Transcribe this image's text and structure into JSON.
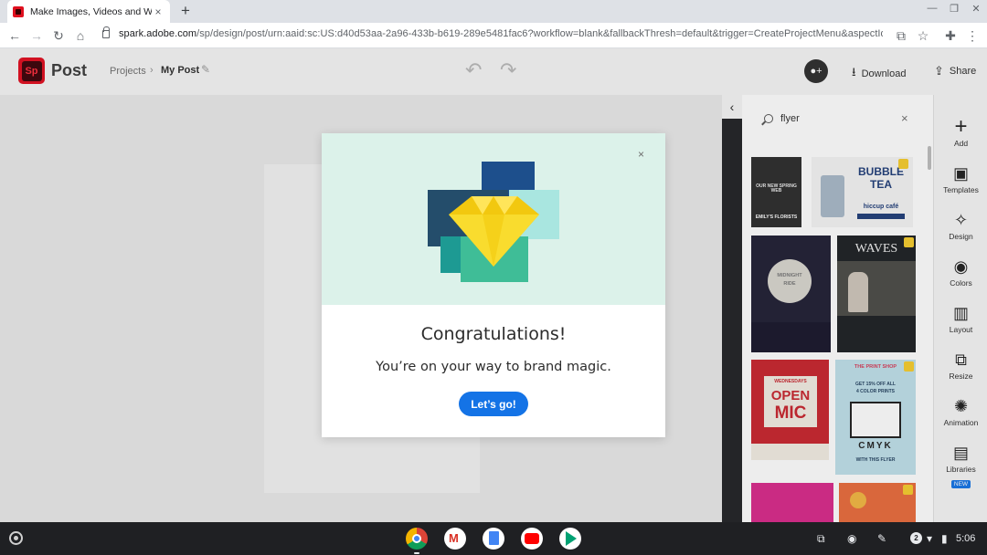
{
  "browser": {
    "tab_title": "Make Images, Videos and Web St",
    "tab_close": "×",
    "new_tab": "+",
    "url_host": "spark.adobe.com",
    "url_path": "/sp/design/post/urn:aaid:sc:US:d40d53aa-2a96-433b-b619-289e5481fac6?workflow=blank&fallbackThresh=default&trigger=CreateProjectMenu&aspectId=Post..."
  },
  "app": {
    "logo_text": "Sp",
    "title": "Post",
    "breadcrumb_projects": "Projects",
    "breadcrumb_sep": "›",
    "breadcrumb_current": "My Post",
    "download_label": "Download",
    "share_label": "Share"
  },
  "panel": {
    "search_value": "flyer",
    "clear": "×",
    "collapse": "‹"
  },
  "templates": {
    "t1": "EMILY'S FLORISTS",
    "t1b": "OUR NEW SPRING WEB",
    "t2a": "BUBBLE",
    "t2b": "TEA",
    "t2c": "hiccup café",
    "t3a": "MIDNIGHT",
    "t3b": "RIDE",
    "t4": "WAVES",
    "t5a": "WEDNESDAYS",
    "t5b": "OPEN",
    "t5c": "MIC",
    "t6a": "THE PRINT SHOP",
    "t6b": "GET 15% OFF ALL",
    "t6c": "4 COLOR PRINTS",
    "t6d": "CMYK",
    "t6e": "WITH THIS FLYER"
  },
  "rail": [
    {
      "label": "Add",
      "icon": "+"
    },
    {
      "label": "Templates",
      "icon": "▣"
    },
    {
      "label": "Design",
      "icon": "✧"
    },
    {
      "label": "Colors",
      "icon": "◉"
    },
    {
      "label": "Layout",
      "icon": "▥"
    },
    {
      "label": "Resize",
      "icon": "⧉"
    },
    {
      "label": "Animation",
      "icon": "✺"
    },
    {
      "label": "Libraries",
      "icon": "▤",
      "badge": "NEW"
    }
  ],
  "modal": {
    "close": "×",
    "title": "Congratulations!",
    "subtitle": "You’re on your way to brand magic.",
    "cta": "Let’s go!"
  },
  "shelf": {
    "notification_count": "2",
    "time": "5:06"
  },
  "colors": {
    "accent": "#1473e6",
    "brand_red": "#e00b1c",
    "modal_hero": "#dcf2ea"
  }
}
